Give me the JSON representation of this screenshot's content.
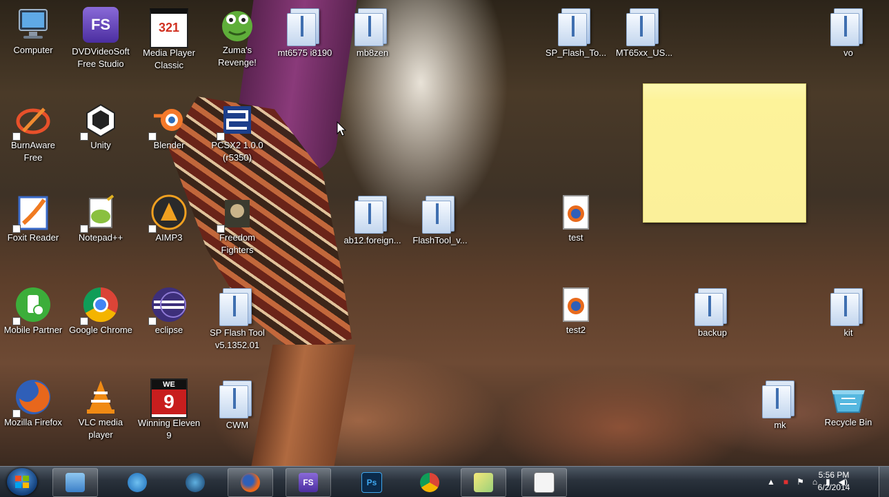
{
  "desktop": {
    "icons": [
      {
        "label": "Computer"
      },
      {
        "label": "DVDVideoSoft Free Studio"
      },
      {
        "label": "Media Player Classic"
      },
      {
        "label": "Zuma's Revenge!"
      },
      {
        "label": "mt6575 i8190"
      },
      {
        "label": "mb8zen"
      },
      {
        "label": "SP_Flash_To..."
      },
      {
        "label": "MT65xx_US..."
      },
      {
        "label": "vo"
      },
      {
        "label": "BurnAware Free"
      },
      {
        "label": "Unity"
      },
      {
        "label": "Blender"
      },
      {
        "label": "PCSX2 1.0.0 (r5350)"
      },
      {
        "label": "Foxit Reader"
      },
      {
        "label": "Notepad++"
      },
      {
        "label": "AIMP3"
      },
      {
        "label": "Freedom Fighters"
      },
      {
        "label": "ab12.foreign..."
      },
      {
        "label": "FlashTool_v..."
      },
      {
        "label": "test"
      },
      {
        "label": "Mobile Partner"
      },
      {
        "label": "Google Chrome"
      },
      {
        "label": "eclipse"
      },
      {
        "label": "SP Flash Tool v5.1352.01"
      },
      {
        "label": "test2"
      },
      {
        "label": "backup"
      },
      {
        "label": "kit"
      },
      {
        "label": "Mozilla Firefox"
      },
      {
        "label": "VLC media player"
      },
      {
        "label": "Winning Eleven 9"
      },
      {
        "label": "CWM"
      },
      {
        "label": "mk"
      },
      {
        "label": "Recycle Bin"
      }
    ],
    "glyphs": {
      "fs": "FS",
      "mpc": "321",
      "ps": "Ps",
      "we9_top": "WE",
      "we9_num": "9"
    }
  },
  "taskbar": {
    "clock": {
      "time": "5:56 PM",
      "date": "6/2/2014"
    }
  },
  "colors": {
    "taskbar": "#2a323c",
    "sticky_note": "#fdf39a",
    "folder": "#a9c3e6"
  }
}
